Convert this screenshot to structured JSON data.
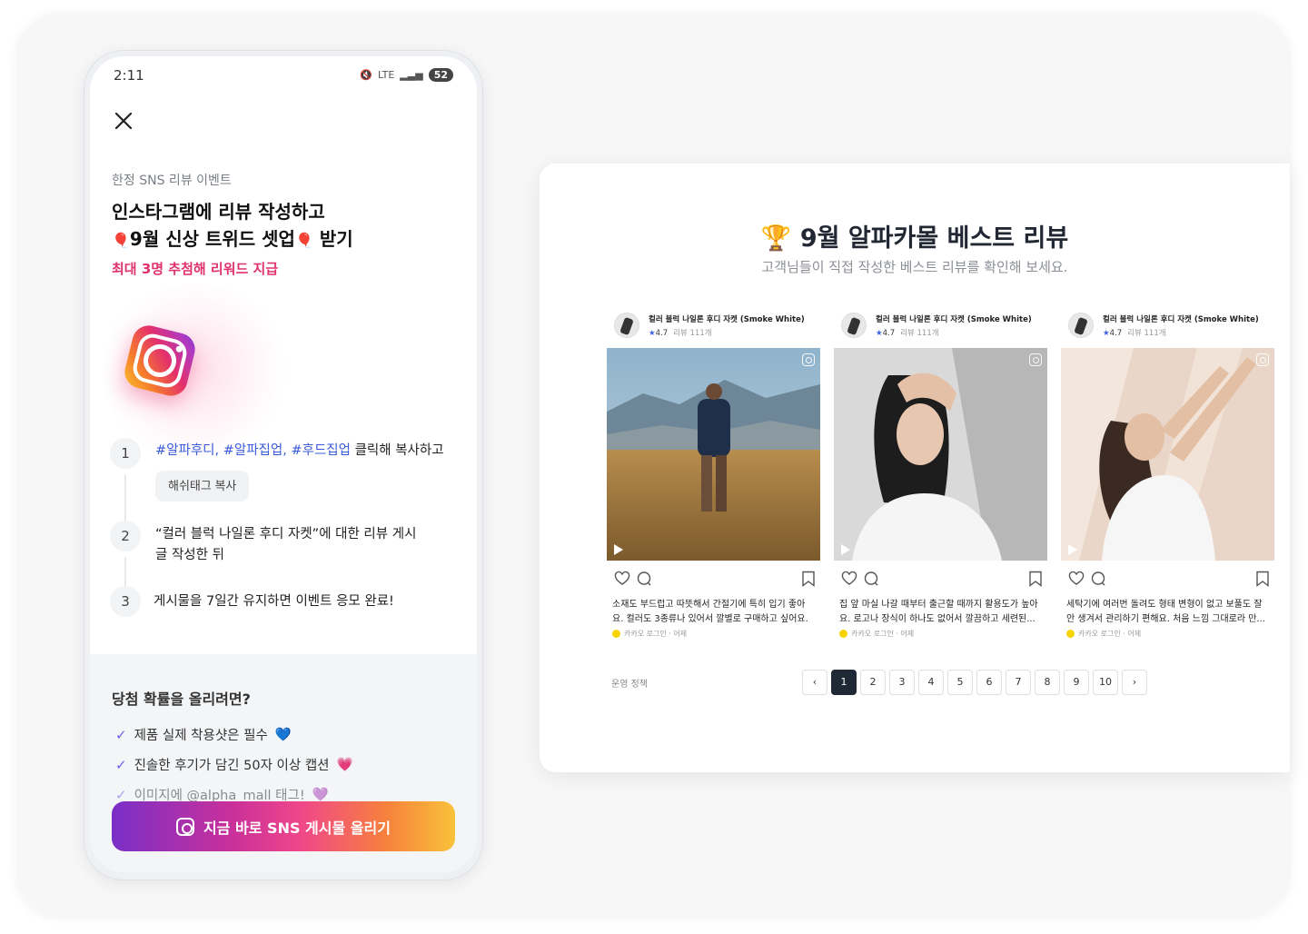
{
  "phone": {
    "status": {
      "time": "2:11",
      "network": "LTE",
      "battery": "52"
    },
    "eyebrow": "한정 SNS 리뷰 이벤트",
    "headline_line1": "인스타그램에 리뷰 작성하고",
    "headline_line2": "9월 신상 트위드 셋업",
    "headline_line2_end": "받기",
    "accent": "최대 3명 추첨해 리워드 지급",
    "steps": [
      {
        "num": "1",
        "tags": "#알파후디, #알파집업, #후드집업",
        "text": " 클릭해 복사하고",
        "button": "해쉬태그 복사"
      },
      {
        "num": "2",
        "text_line1": "“컬러 블럭 나일론 후디 자켓”에 대한 리뷰 게시",
        "text_line2": "글 작성한 뒤"
      },
      {
        "num": "3",
        "text": "게시물을 7일간 유지하면 이벤트 응모 완료!"
      }
    ],
    "tips_title": "당첨 확률을 올리려면?",
    "tips": [
      {
        "text": "제품 실제 착용샷은 필수",
        "emoji": "💙"
      },
      {
        "text": "진솔한 후기가 담긴 50자 이상 캡션",
        "emoji": "💗"
      },
      {
        "text": "이미지에 @alpha_mall 태그!",
        "emoji": "💜"
      }
    ],
    "cta": "지금 바로 SNS 게시물 올리기"
  },
  "panel": {
    "title": "9월 알파카몰 베스트 리뷰",
    "subtitle": "고객님들이 직접 작성한 베스트 리뷰를 확인해 보세요.",
    "cards": [
      {
        "product": "컬러 블럭 나일론 후디 자켓 (Smoke White)",
        "rating": "4.7",
        "reviews": "리뷰 111개",
        "review_line1": "소재도 부드럽고 따뜻해서 간절기에 특히 입기 좋아",
        "review_line2": "요. 컬러도 3종류나 있어서 깔별로 구매하고 싶어요.",
        "author": "카카오 로그인 · 어제"
      },
      {
        "product": "컬러 블럭 나일론 후디 자켓 (Smoke White)",
        "rating": "4.7",
        "reviews": "리뷰 111개",
        "review_line1": "집 앞 마실 나갈 때부터 출근할 때까지 활용도가 높아",
        "review_line2": "요. 로고나 장식이 하나도 없어서 깔끔하고 세련된...",
        "author": "카카오 로그인 · 어제"
      },
      {
        "product": "컬러 블럭 나일론 후디 자켓 (Smoke White)",
        "rating": "4.7",
        "reviews": "리뷰 111개",
        "review_line1": "세탁기에 여러번 돌려도 형태 변형이 없고 보풀도 잘",
        "review_line2": "안 생겨서 관리하기 편해요. 처음 느낌 그대로라 만...",
        "author": "카카오 로그인 · 어제"
      }
    ],
    "policy": "운영 정책",
    "pages": [
      "1",
      "2",
      "3",
      "4",
      "5",
      "6",
      "7",
      "8",
      "9",
      "10"
    ],
    "current_page": "1"
  }
}
